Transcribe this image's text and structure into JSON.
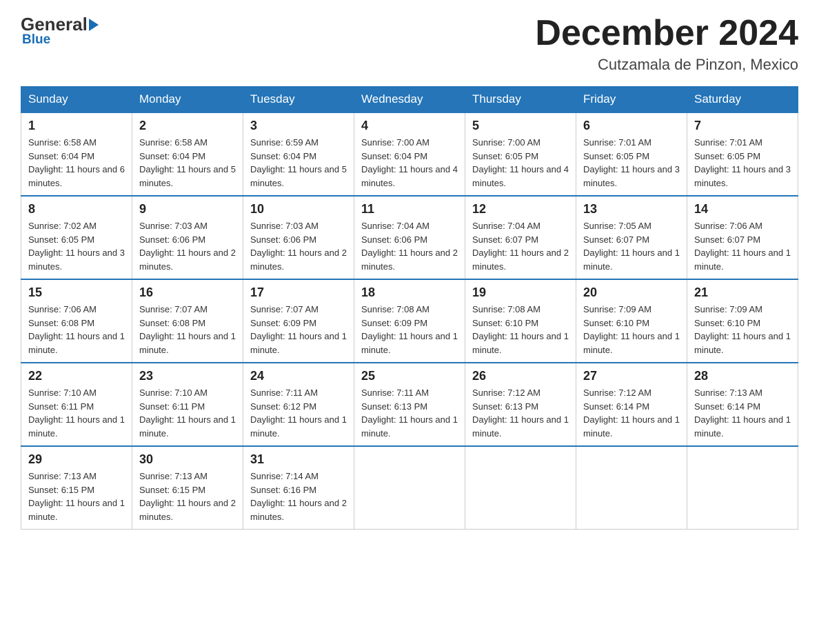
{
  "header": {
    "logo": {
      "general": "General",
      "arrow": "",
      "blue": "Blue"
    },
    "month_title": "December 2024",
    "location": "Cutzamala de Pinzon, Mexico"
  },
  "weekdays": [
    "Sunday",
    "Monday",
    "Tuesday",
    "Wednesday",
    "Thursday",
    "Friday",
    "Saturday"
  ],
  "weeks": [
    [
      {
        "day": "1",
        "sunrise": "6:58 AM",
        "sunset": "6:04 PM",
        "daylight": "11 hours and 6 minutes."
      },
      {
        "day": "2",
        "sunrise": "6:58 AM",
        "sunset": "6:04 PM",
        "daylight": "11 hours and 5 minutes."
      },
      {
        "day": "3",
        "sunrise": "6:59 AM",
        "sunset": "6:04 PM",
        "daylight": "11 hours and 5 minutes."
      },
      {
        "day": "4",
        "sunrise": "7:00 AM",
        "sunset": "6:04 PM",
        "daylight": "11 hours and 4 minutes."
      },
      {
        "day": "5",
        "sunrise": "7:00 AM",
        "sunset": "6:05 PM",
        "daylight": "11 hours and 4 minutes."
      },
      {
        "day": "6",
        "sunrise": "7:01 AM",
        "sunset": "6:05 PM",
        "daylight": "11 hours and 3 minutes."
      },
      {
        "day": "7",
        "sunrise": "7:01 AM",
        "sunset": "6:05 PM",
        "daylight": "11 hours and 3 minutes."
      }
    ],
    [
      {
        "day": "8",
        "sunrise": "7:02 AM",
        "sunset": "6:05 PM",
        "daylight": "11 hours and 3 minutes."
      },
      {
        "day": "9",
        "sunrise": "7:03 AM",
        "sunset": "6:06 PM",
        "daylight": "11 hours and 2 minutes."
      },
      {
        "day": "10",
        "sunrise": "7:03 AM",
        "sunset": "6:06 PM",
        "daylight": "11 hours and 2 minutes."
      },
      {
        "day": "11",
        "sunrise": "7:04 AM",
        "sunset": "6:06 PM",
        "daylight": "11 hours and 2 minutes."
      },
      {
        "day": "12",
        "sunrise": "7:04 AM",
        "sunset": "6:07 PM",
        "daylight": "11 hours and 2 minutes."
      },
      {
        "day": "13",
        "sunrise": "7:05 AM",
        "sunset": "6:07 PM",
        "daylight": "11 hours and 1 minute."
      },
      {
        "day": "14",
        "sunrise": "7:06 AM",
        "sunset": "6:07 PM",
        "daylight": "11 hours and 1 minute."
      }
    ],
    [
      {
        "day": "15",
        "sunrise": "7:06 AM",
        "sunset": "6:08 PM",
        "daylight": "11 hours and 1 minute."
      },
      {
        "day": "16",
        "sunrise": "7:07 AM",
        "sunset": "6:08 PM",
        "daylight": "11 hours and 1 minute."
      },
      {
        "day": "17",
        "sunrise": "7:07 AM",
        "sunset": "6:09 PM",
        "daylight": "11 hours and 1 minute."
      },
      {
        "day": "18",
        "sunrise": "7:08 AM",
        "sunset": "6:09 PM",
        "daylight": "11 hours and 1 minute."
      },
      {
        "day": "19",
        "sunrise": "7:08 AM",
        "sunset": "6:10 PM",
        "daylight": "11 hours and 1 minute."
      },
      {
        "day": "20",
        "sunrise": "7:09 AM",
        "sunset": "6:10 PM",
        "daylight": "11 hours and 1 minute."
      },
      {
        "day": "21",
        "sunrise": "7:09 AM",
        "sunset": "6:10 PM",
        "daylight": "11 hours and 1 minute."
      }
    ],
    [
      {
        "day": "22",
        "sunrise": "7:10 AM",
        "sunset": "6:11 PM",
        "daylight": "11 hours and 1 minute."
      },
      {
        "day": "23",
        "sunrise": "7:10 AM",
        "sunset": "6:11 PM",
        "daylight": "11 hours and 1 minute."
      },
      {
        "day": "24",
        "sunrise": "7:11 AM",
        "sunset": "6:12 PM",
        "daylight": "11 hours and 1 minute."
      },
      {
        "day": "25",
        "sunrise": "7:11 AM",
        "sunset": "6:13 PM",
        "daylight": "11 hours and 1 minute."
      },
      {
        "day": "26",
        "sunrise": "7:12 AM",
        "sunset": "6:13 PM",
        "daylight": "11 hours and 1 minute."
      },
      {
        "day": "27",
        "sunrise": "7:12 AM",
        "sunset": "6:14 PM",
        "daylight": "11 hours and 1 minute."
      },
      {
        "day": "28",
        "sunrise": "7:13 AM",
        "sunset": "6:14 PM",
        "daylight": "11 hours and 1 minute."
      }
    ],
    [
      {
        "day": "29",
        "sunrise": "7:13 AM",
        "sunset": "6:15 PM",
        "daylight": "11 hours and 1 minute."
      },
      {
        "day": "30",
        "sunrise": "7:13 AM",
        "sunset": "6:15 PM",
        "daylight": "11 hours and 2 minutes."
      },
      {
        "day": "31",
        "sunrise": "7:14 AM",
        "sunset": "6:16 PM",
        "daylight": "11 hours and 2 minutes."
      },
      null,
      null,
      null,
      null
    ]
  ]
}
